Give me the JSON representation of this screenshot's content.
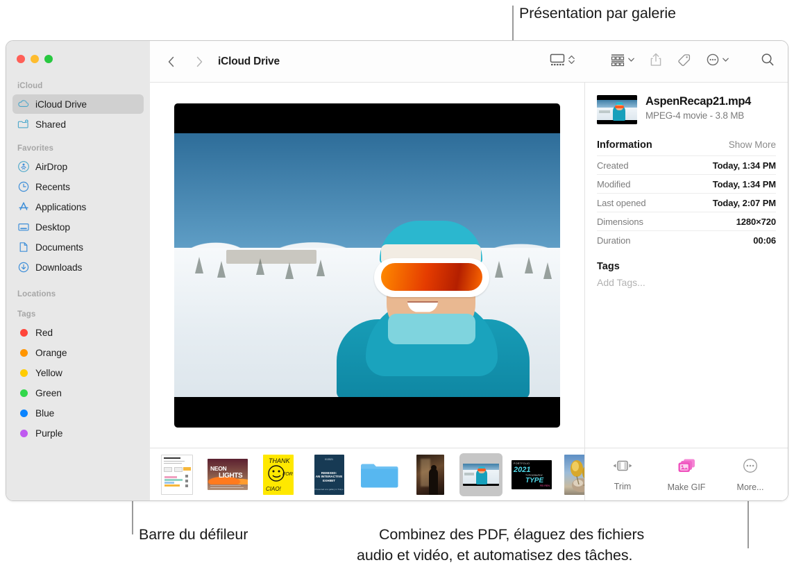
{
  "callouts": {
    "top": "Présentation par galerie",
    "bottom_left": "Barre du défileur",
    "bottom_right_line1": "Combinez des PDF, élaguez des fichiers",
    "bottom_right_line2": "audio et vidéo, et automatisez des tâches."
  },
  "window": {
    "traffic_lights": [
      "close",
      "minimize",
      "zoom"
    ]
  },
  "sidebar": {
    "groups": [
      {
        "title": "iCloud",
        "items": [
          {
            "label": "iCloud Drive",
            "icon": "cloud-icon",
            "selected": true
          },
          {
            "label": "Shared",
            "icon": "shared-folder-icon",
            "selected": false
          }
        ]
      },
      {
        "title": "Favorites",
        "items": [
          {
            "label": "AirDrop",
            "icon": "airdrop-icon",
            "selected": false
          },
          {
            "label": "Recents",
            "icon": "clock-icon",
            "selected": false
          },
          {
            "label": "Applications",
            "icon": "app-store-icon",
            "selected": false
          },
          {
            "label": "Desktop",
            "icon": "desktop-icon",
            "selected": false
          },
          {
            "label": "Documents",
            "icon": "document-icon",
            "selected": false
          },
          {
            "label": "Downloads",
            "icon": "download-icon",
            "selected": false
          }
        ]
      },
      {
        "title": "Locations",
        "items": []
      },
      {
        "title": "Tags",
        "items": [
          {
            "label": "Red",
            "icon": "tag-dot-icon",
            "color": "#ff453a"
          },
          {
            "label": "Orange",
            "icon": "tag-dot-icon",
            "color": "#ff9500"
          },
          {
            "label": "Yellow",
            "icon": "tag-dot-icon",
            "color": "#ffcc00"
          },
          {
            "label": "Green",
            "icon": "tag-dot-icon",
            "color": "#32d74b"
          },
          {
            "label": "Blue",
            "icon": "tag-dot-icon",
            "color": "#0a84ff"
          },
          {
            "label": "Purple",
            "icon": "tag-dot-icon",
            "color": "#bf5af0"
          }
        ]
      }
    ]
  },
  "toolbar": {
    "back_icon": "chevron-left-icon",
    "forward_icon": "chevron-right-icon",
    "breadcrumb": "iCloud Drive",
    "view_gallery_icon": "gallery-view-icon",
    "view_chevron_icon": "chevron-up-down-icon",
    "group_icon": "group-by-icon",
    "group_chevron_icon": "chevron-down-icon",
    "share_icon": "share-icon",
    "tag_icon": "tag-icon",
    "more_icon": "more-circle-icon",
    "more_chevron_icon": "chevron-down-icon",
    "search_icon": "search-icon"
  },
  "preview": {
    "media_name": "AspenRecap21 video preview",
    "media_type": "video"
  },
  "thumbnails": [
    {
      "name": "infographic-document",
      "kind": "document"
    },
    {
      "name": "neon-lights-poster",
      "kind": "image"
    },
    {
      "name": "thank-you-ciao-poster",
      "kind": "image"
    },
    {
      "name": "remixed-exhibit-poster",
      "kind": "image"
    },
    {
      "name": "blue-folder",
      "kind": "folder"
    },
    {
      "name": "silhouette-photo",
      "kind": "image"
    },
    {
      "name": "aspen-recap-video",
      "kind": "video",
      "selected": true
    },
    {
      "name": "portfolio-2021-type-poster",
      "kind": "image"
    },
    {
      "name": "gold-sculpture-photo",
      "kind": "image"
    }
  ],
  "info": {
    "file_name": "AspenRecap21.mp4",
    "file_meta": "MPEG-4 movie - 3.8 MB",
    "section_title": "Information",
    "show_more": "Show More",
    "rows": [
      {
        "key": "Created",
        "value": "Today, 1:34 PM"
      },
      {
        "key": "Modified",
        "value": "Today, 1:34 PM"
      },
      {
        "key": "Last opened",
        "value": "Today, 2:07 PM"
      },
      {
        "key": "Dimensions",
        "value": "1280×720"
      },
      {
        "key": "Duration",
        "value": "00:06"
      }
    ],
    "tags_title": "Tags",
    "tags_placeholder": "Add Tags..."
  },
  "quick_actions": [
    {
      "label": "Trim",
      "icon": "trim-icon"
    },
    {
      "label": "Make GIF",
      "icon": "make-gif-icon"
    },
    {
      "label": "More...",
      "icon": "more-circle-icon"
    }
  ],
  "colors": {
    "accent": "#0a84ff",
    "sidebar_bg": "#e8e8e8",
    "selection": "#d0d0d0",
    "gif_pink": "#f35bc6"
  }
}
